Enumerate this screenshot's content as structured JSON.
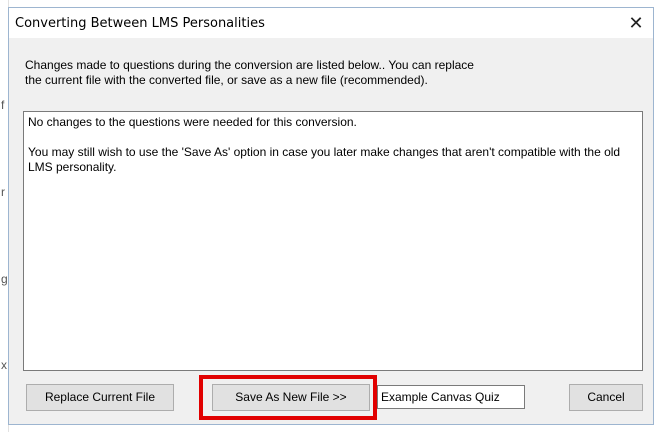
{
  "background": {
    "glyphs": [
      "f",
      "r",
      "g",
      "x"
    ]
  },
  "dialog": {
    "title": "Converting Between LMS Personalities",
    "close_symbol": "✕",
    "intro_line1": "Changes made to questions during the conversion are listed below..  You can replace",
    "intro_line2": "the current file with the converted file, or save as a new file (recommended).",
    "messages": {
      "line1": "No changes to the questions were needed for this conversion.",
      "line2": "You may still wish to use the 'Save As' option in case you later make changes that aren't compatible with the old LMS personality."
    },
    "buttons": {
      "replace": "Replace Current File",
      "save_as": "Save As New File >>",
      "cancel": "Cancel"
    },
    "filename_value": "Example Canvas Quiz"
  },
  "colors": {
    "highlight": "#e10000",
    "dialog_bg": "#f0f0f0"
  }
}
